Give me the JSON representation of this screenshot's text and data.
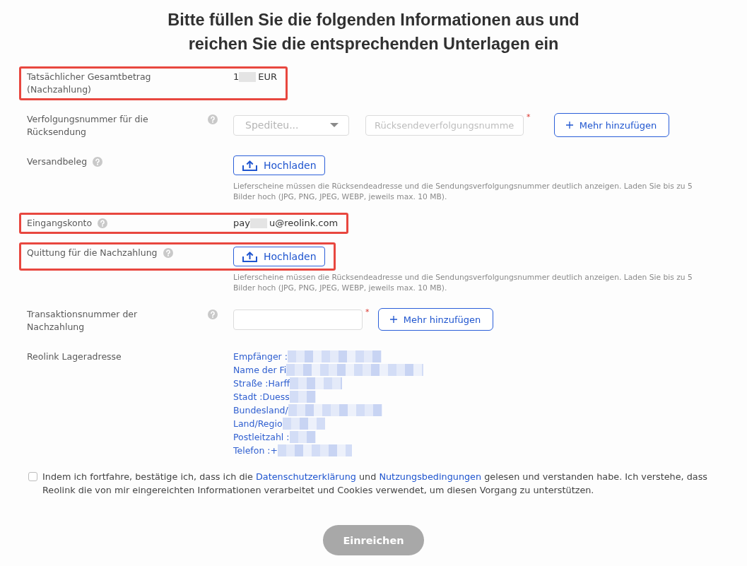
{
  "title": "Bitte füllen Sie die folgenden Informationen aus und reichen Sie die entsprechenden Unterlagen ein",
  "rows": [
    {
      "kind": "value",
      "label": "Tatsächlicher Gesamtbetrag (Nachzahlung)",
      "help": false,
      "highlighted": true,
      "value": {
        "before": "1",
        "redacted": true,
        "after": "EUR"
      }
    },
    {
      "kind": "tracking",
      "label": "Verfolgungsnummer für die Rücksendung",
      "help": true,
      "highlighted": false,
      "select": {
        "placeholder": "Spediteu..."
      },
      "input": {
        "placeholder": "Rücksendeverfolgungsnumme",
        "required_mark": "*"
      },
      "add_button": "Mehr hinzufügen"
    },
    {
      "kind": "upload",
      "label": "Versandbeleg",
      "help": true,
      "highlighted": false,
      "button": "Hochladen",
      "hint": "Lieferscheine müssen die Rücksendeadresse und die Sendungsverfolgungsnummer deutlich anzeigen. Laden Sie bis zu 5 Bilder hoch (JPG, PNG, JPEG, WEBP, jeweils max. 10 MB)."
    },
    {
      "kind": "value",
      "label": "Eingangskonto",
      "help": true,
      "highlighted": true,
      "value": {
        "before": "pay",
        "redacted": true,
        "after": "u@reolink.com"
      }
    },
    {
      "kind": "upload",
      "label": "Quittung für die Nachzahlung",
      "help": true,
      "highlighted": true,
      "button": "Hochladen",
      "hint": "Lieferscheine müssen die Rücksendeadresse und die Sendungsverfolgungsnummer deutlich anzeigen. Laden Sie bis zu 5 Bilder hoch (JPG, PNG, JPEG, WEBP, jeweils max. 10 MB)."
    },
    {
      "kind": "input_add",
      "label": "Transaktionsnummer der Nachzahlung",
      "help": true,
      "highlighted": false,
      "input": {
        "required_mark": "*"
      },
      "add_button": "Mehr hinzufügen"
    },
    {
      "kind": "address",
      "label": "Reolink Lageradresse",
      "help": false,
      "highlighted": false,
      "lines": [
        {
          "text": "Empfänger :",
          "redacted": true
        },
        {
          "text": "Name der Fi",
          "redacted": true
        },
        {
          "text": "Straße :Harff",
          "redacted": true
        },
        {
          "text": "Stadt :Duess",
          "redacted": true
        },
        {
          "text": "Bundesland/",
          "redacted": true
        },
        {
          "text": "Land/Regio",
          "redacted": true
        },
        {
          "text": "Postleitzahl :",
          "redacted": true
        },
        {
          "text": "Telefon :+",
          "redacted": true
        }
      ]
    }
  ],
  "consent": {
    "checked": false,
    "parts": [
      {
        "kind": "text",
        "text": "Indem ich fortfahre, bestätige ich, dass ich die"
      },
      {
        "kind": "link",
        "text": "Datenschutzerklärung"
      },
      {
        "kind": "text",
        "text": "und"
      },
      {
        "kind": "link",
        "text": "Nutzungsbedingungen"
      },
      {
        "kind": "text",
        "text": "gelesen und verstanden habe. Ich verstehe, dass Reolink die von mir eingereichten Informationen verarbeitet und Cookies verwendet, um diesen Vorgang zu unterstützen."
      }
    ]
  },
  "submit": {
    "label": "Einreichen",
    "disabled": true
  }
}
